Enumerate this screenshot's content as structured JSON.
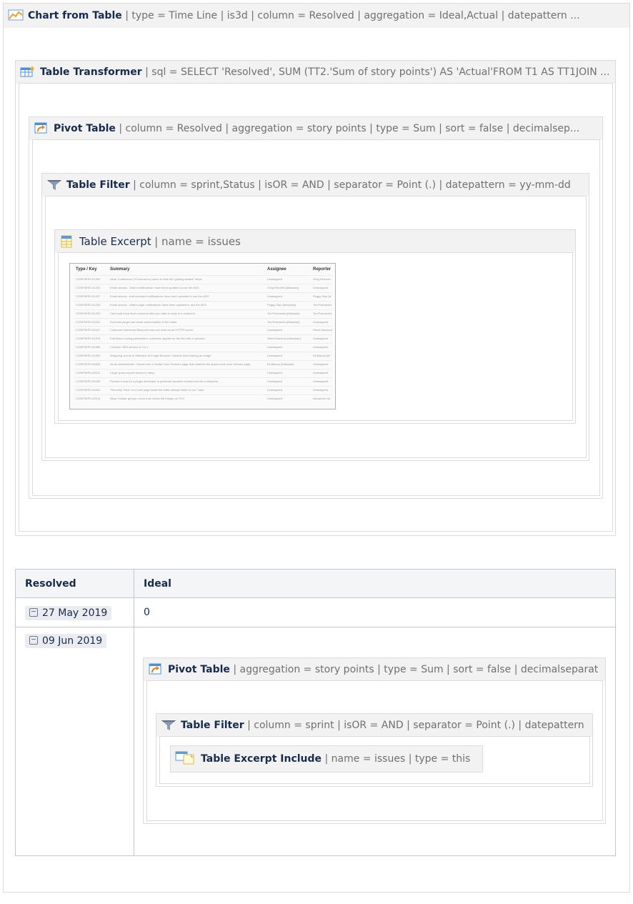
{
  "chart_macro": {
    "name": "Chart from Table",
    "params": "| type = Time Line | is3d | column = Resolved | aggregation = Ideal,Actual | datepattern ..."
  },
  "transformer_macro": {
    "name": "Table Transformer",
    "params": "| sql = SELECT 'Resolved', SUM (TT2.'Sum of story points') AS 'Actual'FROM T1 AS TT1JOIN ..."
  },
  "pivot_macro": {
    "name": "Pivot Table",
    "params": "| column = Resolved | aggregation = story points | type = Sum | sort = false | decimalsep..."
  },
  "filter_macro": {
    "name": "Table Filter",
    "params": "| column = sprint,Status | isOR = AND | separator = Point (.) | datepattern = yy-mm-dd"
  },
  "excerpt_macro": {
    "name": "Table Excerpt",
    "params": "| name = issues"
  },
  "excerpt_preview": {
    "headers": [
      "Type / Key",
      "Summary",
      "Assignee",
      "Reporter"
    ],
    "rows": [
      [
        "CONFSERV-51262",
        "Allow Confluence (\"eCommerce) users to hide the \"getting started\" steps",
        "Unassigned",
        "Greg Reichelt"
      ],
      [
        "CONFSERV-51251",
        "Email access - Share notifications: have been updated to use the ADG",
        "Greg Reichelt [Atlassian]",
        "Unassigned"
      ],
      [
        "CONFSERV-51227",
        "Email access - Add comment notifications: have been updated to use the ADG",
        "Unassigned",
        "Peggy Siao [A"
      ],
      [
        "CONFSERV-51225",
        "Email access - Watch page notifications: have been updated to use the ADG",
        "Peggy Siao [Atlassian]",
        "Ted Piotrowski"
      ],
      [
        "CONFSERV-51223",
        "Can't add a top level comment after you start to reply to a comment",
        "Ted Piotrowski [Atlassian]",
        "Ted Piotrowski"
      ],
      [
        "CONFSERV-51181",
        "Evernote plugin can break autocomplete in the editor",
        "Ted Piotrowski [Atlassian]",
        "Unassigned"
      ],
      [
        "CONFSERV-51167",
        "Customer interviews Blueprint does not work on an HTTPS server",
        "Unassigned",
        "Sherif Mansour"
      ],
      [
        "CONFSERV-51076",
        "Edit Macro during parameters' comment, applies on the link with in preview",
        "Sherif Mansour [Atlassian]",
        "Unassigned"
      ],
      [
        "CONFSERV-51065",
        "Conform JIRA version to 3.0.1",
        "Unassigned",
        "Unassigned"
      ],
      [
        "CONFSERV-51053",
        "Wrapping occurs in Selection of Image Browser / Search when having an image",
        "Unassigned",
        "Eli Bishop [At"
      ],
      [
        "CONFSERV-50834",
        "As an administrator I should see a Global Color Scheme page that matches the space tools color scheme page",
        "Eli Bishop [Atlassian]",
        "Unassigned"
      ],
      [
        "CONFSERV-50511",
        "Large space export seems to hang",
        "Unassigned",
        "Unassigned"
      ],
      [
        "CONFSERV-50420",
        "Provide a way for a plugin developer to generate dynamic content into the in blueprint",
        "Unassigned",
        "Unassigned"
      ],
      [
        "CONFSERV-50401",
        "\"Recently Tried\" on a new page loads the editor always blank on our 'Labs'",
        "Unassigned",
        "Unassigned"
      ],
      [
        "CONFSERV-50314",
        "Allow Toolbar groups: move from below left margin on PLG",
        "Unassigned",
        "Alexander Da"
      ]
    ]
  },
  "table": {
    "headers": [
      "Resolved",
      "Ideal"
    ],
    "rows": [
      {
        "resolved": "27 May 2019",
        "ideal": "0"
      },
      {
        "resolved": "09 Jun 2019",
        "ideal": ""
      }
    ]
  },
  "inner_pivot_macro": {
    "name": "Pivot Table",
    "params": "| aggregation = story points | type = Sum | sort = false | decimalseparat"
  },
  "inner_filter_macro": {
    "name": "Table Filter",
    "params": "| column = sprint | isOR = AND | separator = Point (.) | datepattern"
  },
  "include_macro": {
    "name": "Table Excerpt Include",
    "params": "| name = issues | type = this"
  },
  "icon_names": [
    "chart-icon",
    "table-transformer-icon",
    "pivot-table-icon",
    "table-filter-icon",
    "table-excerpt-icon",
    "calendar-icon",
    "table-excerpt-include-icon"
  ]
}
